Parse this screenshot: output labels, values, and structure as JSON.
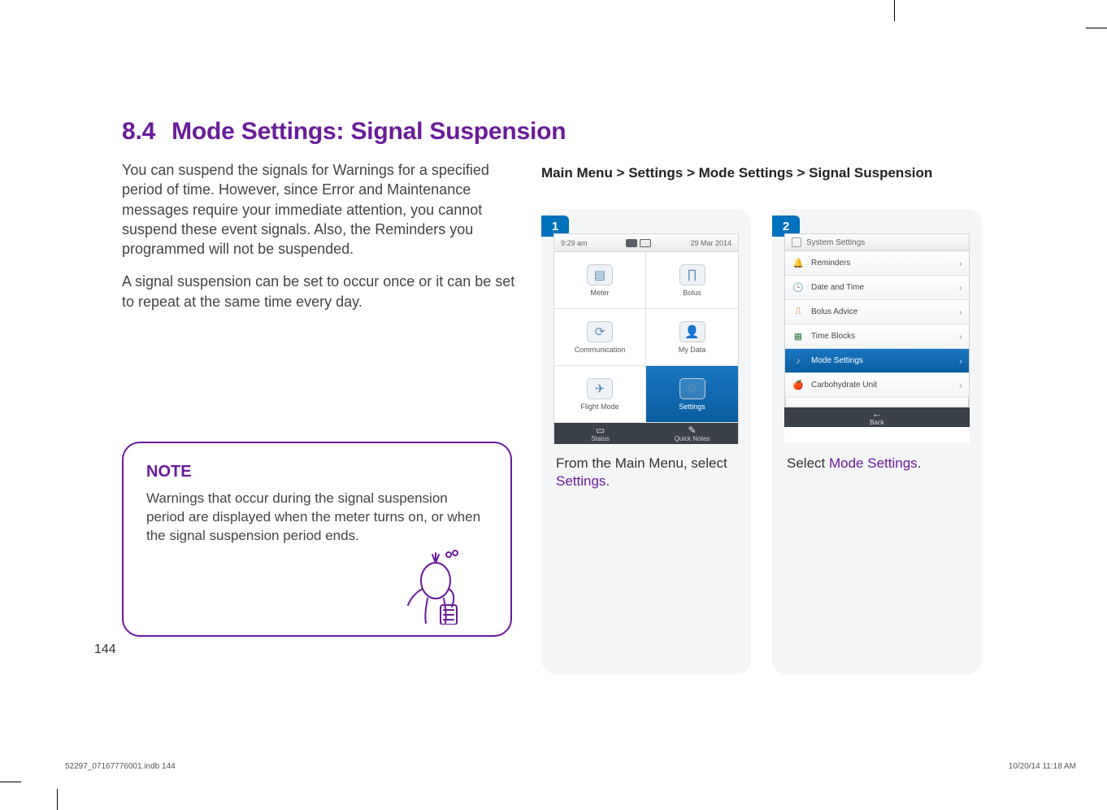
{
  "section": {
    "number": "8.4",
    "title": "Mode Settings: Signal Suspension"
  },
  "paragraphs": {
    "p1": "You can suspend the signals for Warnings for a specified period of time. However, since Error and Maintenance messages require your immediate attention, you cannot suspend these event signals. Also, the Reminders you programmed will not be suspended.",
    "p2": "A signal suspension can be set to occur once or it can be set to repeat at the same time every day."
  },
  "note": {
    "heading": "NOTE",
    "text": "Warnings that occur during the signal suspension period are displayed when the meter turns on, or when the signal suspension period ends."
  },
  "breadcrumb": "Main Menu > Settings > Mode Settings > Signal Suspension",
  "steps": {
    "s1": {
      "tag": "1",
      "caption_prefix": "From the Main Menu, select ",
      "caption_link": "Settings",
      "caption_suffix": "."
    },
    "s2": {
      "tag": "2",
      "caption_prefix": "Select ",
      "caption_link": "Mode Settings",
      "caption_suffix": "."
    }
  },
  "device1": {
    "time": "9:29 am",
    "date": "29 Mar 2014",
    "cells": {
      "meter": "Meter",
      "bolus": "Bolus",
      "communication": "Communication",
      "mydata": "My Data",
      "flight": "Flight Mode",
      "settings": "Settings"
    },
    "footer": {
      "status": "Status",
      "quick": "Quick Notes"
    }
  },
  "device2": {
    "header": "System Settings",
    "rows": {
      "reminders": "Reminders",
      "datetime": "Date and Time",
      "bolusadvice": "Bolus Advice",
      "timeblocks": "Time Blocks",
      "modesettings": "Mode Settings",
      "carbunit": "Carbohydrate Unit"
    },
    "back": "Back"
  },
  "page_number": "144",
  "footer_left": "52297_07167776001.indb   144",
  "footer_right": "10/20/14   11:18 AM"
}
